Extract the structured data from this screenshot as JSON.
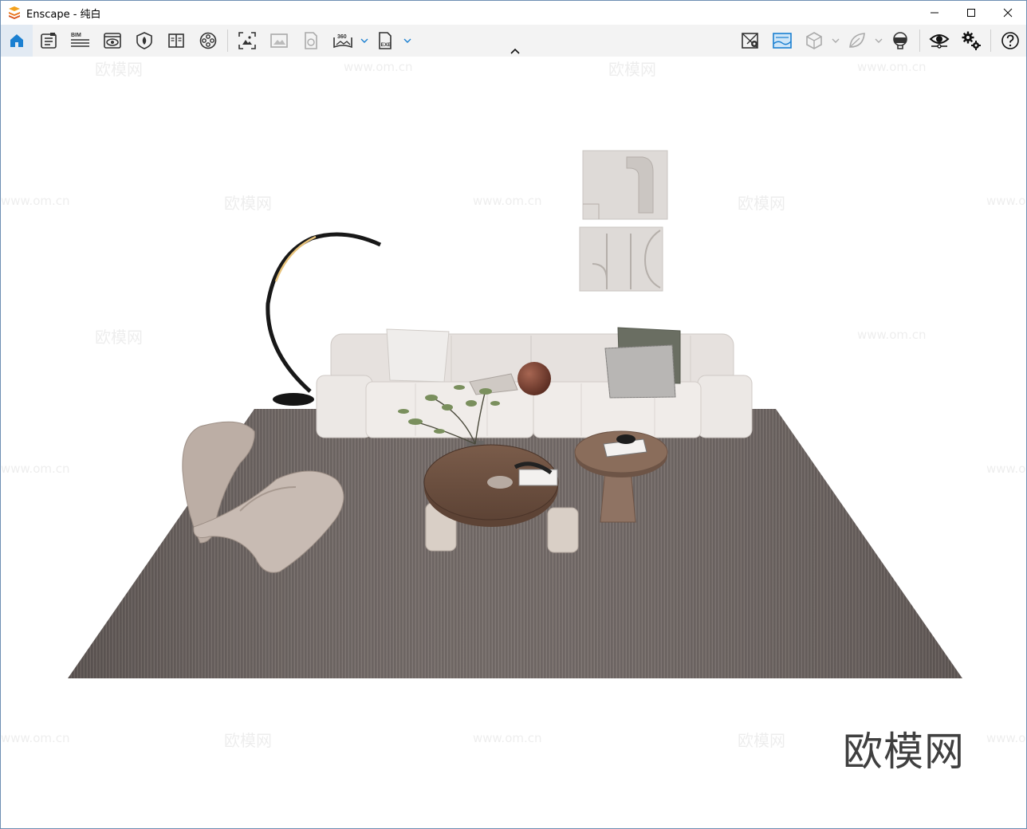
{
  "window": {
    "title": "Enscape - 纯白",
    "controls": [
      "minimize-icon",
      "maximize-icon",
      "close-icon"
    ]
  },
  "toolbar": {
    "left_buttons": [
      {
        "name": "home",
        "icon": "home-icon",
        "active": true
      },
      {
        "name": "document",
        "icon": "document-list-icon"
      },
      {
        "name": "bim",
        "icon": "bim-icon",
        "label": "BIM"
      },
      {
        "name": "view-settings",
        "icon": "eye-window-icon"
      },
      {
        "name": "material",
        "icon": "asset-shield-icon"
      },
      {
        "name": "library",
        "icon": "book-icon"
      },
      {
        "name": "video",
        "icon": "film-reel-icon"
      },
      {
        "name": "screenshot",
        "icon": "screenshot-icon"
      },
      {
        "name": "gallery",
        "icon": "image-gallery-icon"
      },
      {
        "name": "batch-render",
        "icon": "file-render-icon"
      },
      {
        "name": "panorama",
        "icon": "panorama-360-icon",
        "label": "360",
        "dropdown": true
      },
      {
        "name": "export-exe",
        "icon": "export-exe-icon",
        "label": "EXE",
        "dropdown": true
      }
    ],
    "right_buttons": [
      {
        "name": "map",
        "icon": "map-pin-icon"
      },
      {
        "name": "sky",
        "icon": "sky-image-icon"
      },
      {
        "name": "cube",
        "icon": "cube-icon",
        "dropdown": true
      },
      {
        "name": "leaf",
        "icon": "leaf-icon",
        "dropdown": true
      },
      {
        "name": "vr",
        "icon": "vr-headset-icon"
      },
      {
        "name": "visibility",
        "icon": "eye-icon"
      },
      {
        "name": "settings",
        "icon": "gears-icon"
      },
      {
        "name": "help",
        "icon": "help-icon"
      }
    ]
  },
  "viewport": {
    "watermark_text": "欧模网",
    "watermark_url": "www.om.cn",
    "brand_text": "欧模网"
  },
  "colors": {
    "accent": "#1a7fd1",
    "titlebar": "#ffffff",
    "toolbar": "#f3f3f3",
    "rug": "#6e6562",
    "sofa": "#e6e1de"
  }
}
